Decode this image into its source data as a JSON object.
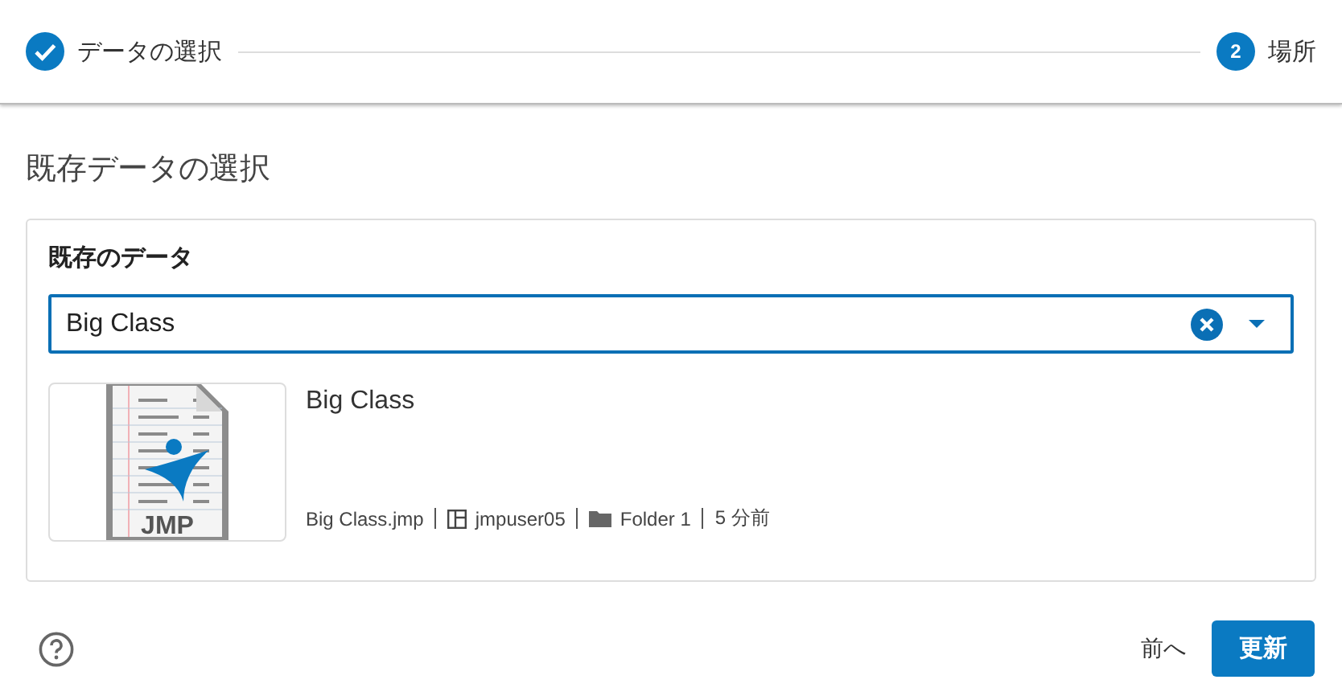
{
  "stepper": {
    "steps": [
      {
        "label": "データの選択",
        "done": true
      },
      {
        "label": "場所",
        "done": false,
        "number": "2"
      }
    ]
  },
  "section_title": "既存データの選択",
  "card": {
    "title": "既存のデータ",
    "combobox": {
      "value": "Big Class"
    },
    "results": [
      {
        "title": "Big Class",
        "thumbnail": {
          "badge": "JMP"
        },
        "file": "Big Class.jmp",
        "owner": "jmpuser05",
        "folder": "Folder 1",
        "time": "5 分前"
      }
    ]
  },
  "footer": {
    "back": "前へ",
    "primary": "更新"
  }
}
